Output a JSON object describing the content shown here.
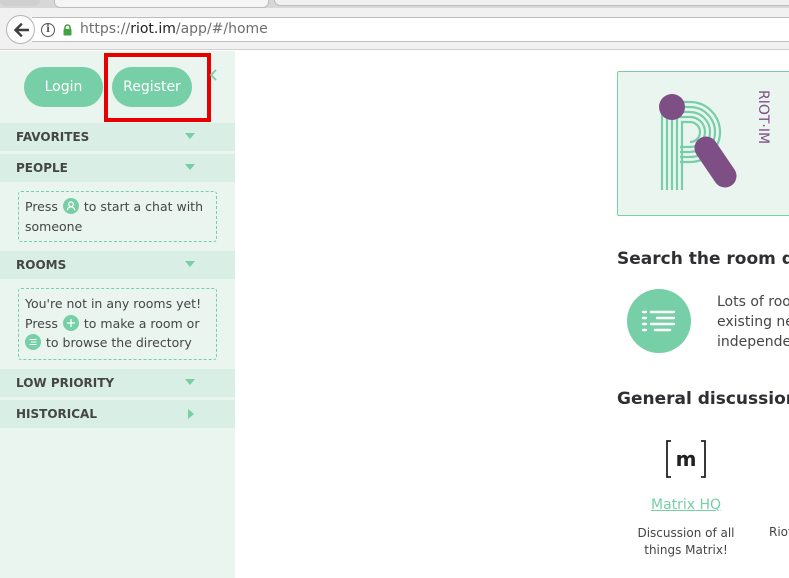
{
  "browser": {
    "url_prefix": "https://",
    "url_host": "riot.im",
    "url_path": "/app/#/home"
  },
  "left_panel": {
    "login_label": "Login",
    "register_label": "Register",
    "sections": {
      "favorites": "FAVORITES",
      "people": "PEOPLE",
      "rooms": "ROOMS",
      "low_priority": "LOW PRIORITY",
      "historical": "HISTORICAL"
    },
    "people_hint": {
      "part1": "Press",
      "part2": "to start a chat with someone"
    },
    "rooms_hint": {
      "line1": "You're not in any rooms yet!",
      "part2": "Press",
      "part3": "to make a room or",
      "part4": "to browse the directory"
    }
  },
  "main": {
    "logo_text": "RIOT·IM",
    "search_heading": "Search the room dir",
    "directory_text": [
      "Lots of roo",
      "existing ne",
      "independe"
    ],
    "general_heading": "General discussion a",
    "rooms": [
      {
        "name": "Matrix HQ",
        "description": "Discussion of all things Matrix!"
      }
    ],
    "next_room_desc": "Riot"
  },
  "colors": {
    "accent": "#76cfa6",
    "panel_bg": "#eaf5f0",
    "logo_purple": "#7e4f85",
    "highlight_red": "#e80000"
  }
}
